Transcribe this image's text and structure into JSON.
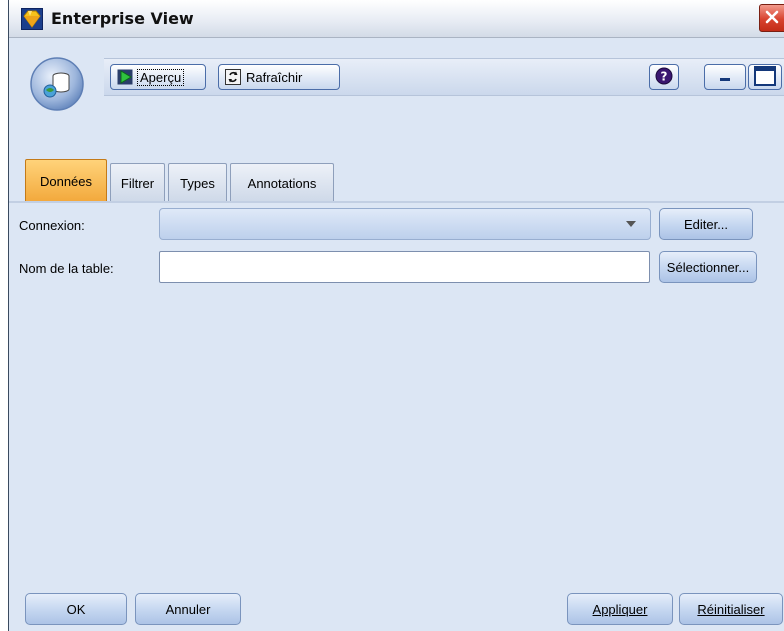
{
  "window": {
    "title": "Enterprise View"
  },
  "toolbar": {
    "preview_label": "Aperçu",
    "refresh_label": "Rafraîchir",
    "help_icon": "question-icon",
    "minimize_icon": "minimize-icon",
    "maximize_icon": "maximize-icon"
  },
  "tabs": [
    {
      "label": "Données",
      "active": true
    },
    {
      "label": "Filtrer",
      "active": false
    },
    {
      "label": "Types",
      "active": false
    },
    {
      "label": "Annotations",
      "active": false
    }
  ],
  "form": {
    "connection_label": "Connexion:",
    "connection_value": "",
    "edit_button": "Editer...",
    "table_label": "Nom de la table:",
    "table_value": "",
    "select_button": "Sélectionner..."
  },
  "footer": {
    "ok": "OK",
    "cancel": "Annuler",
    "apply": "Appliquer",
    "reset": "Réinitialiser"
  },
  "colors": {
    "panel_bg": "#dce6f4",
    "active_tab": "#f2a73a",
    "close_button": "#d8432f"
  }
}
